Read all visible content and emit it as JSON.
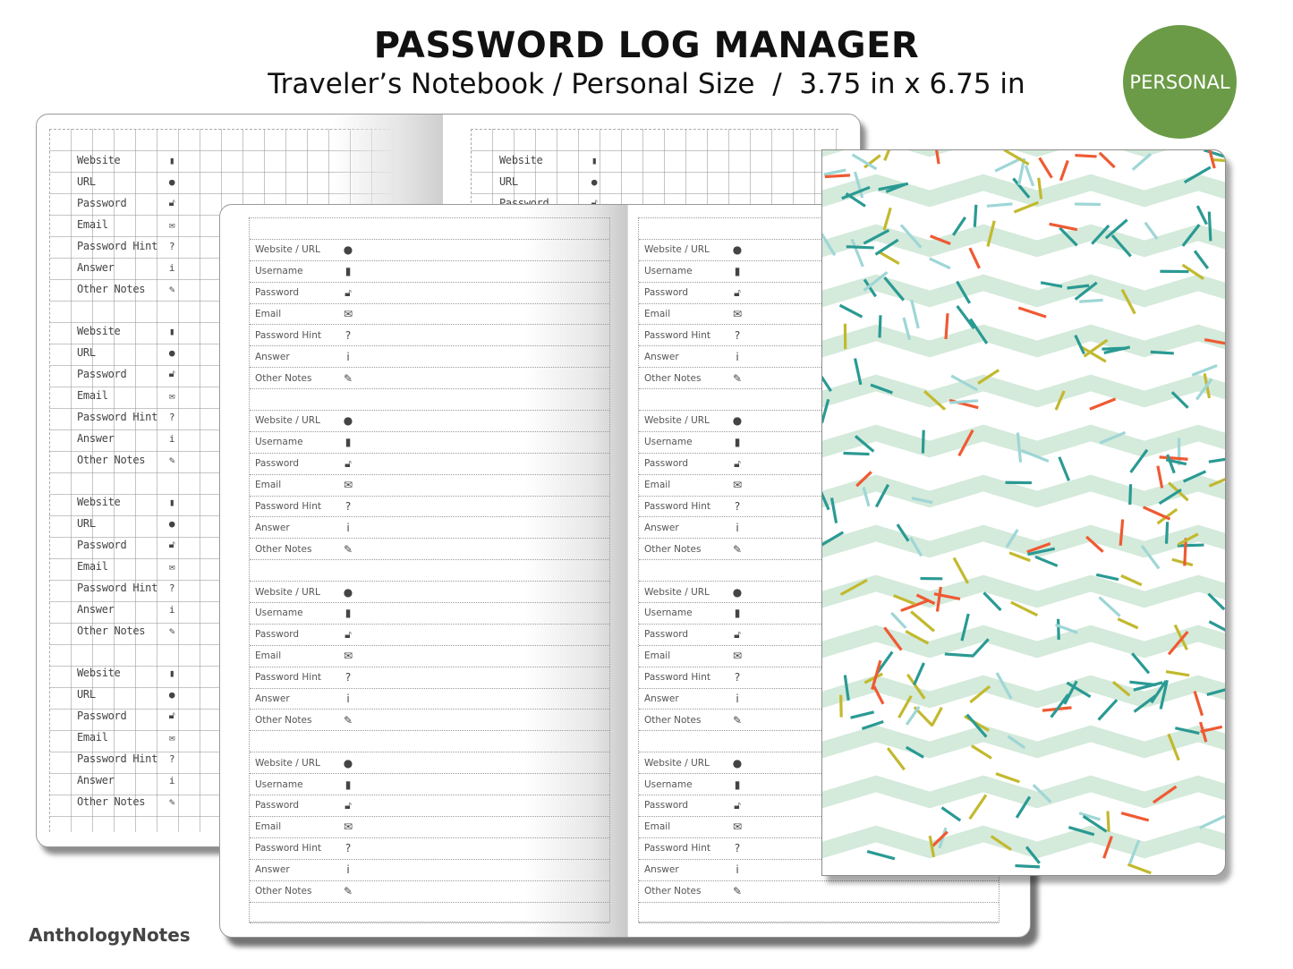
{
  "header": {
    "title": "PASSWORD LOG MANAGER",
    "subtitle": "Traveler’s Notebook / Personal Size  /  3.75 in x 6.75 in"
  },
  "badge": {
    "label": "PERSONAL",
    "color": "#6b9b46"
  },
  "brand": {
    "name": "AnthologyNotes"
  },
  "back_notebook": {
    "entry_fields": [
      {
        "label": "Website",
        "icon": "bookmark-icon",
        "glyph": "▮"
      },
      {
        "label": "URL",
        "icon": "globe-icon",
        "glyph": "●"
      },
      {
        "label": "Password",
        "icon": "unlock-icon",
        "glyph": "🔓︎"
      },
      {
        "label": "Email",
        "icon": "envelope-icon",
        "glyph": "✉"
      },
      {
        "label": "Password Hint",
        "icon": "question-icon",
        "glyph": "?"
      },
      {
        "label": "Answer",
        "icon": "info-icon",
        "glyph": "i"
      },
      {
        "label": "Other Notes",
        "icon": "pencil-icon",
        "glyph": "✎"
      }
    ],
    "entries_per_page": 4
  },
  "front_notebook": {
    "entry_fields": [
      {
        "label": "Website / URL",
        "icon": "globe-icon",
        "glyph": "●"
      },
      {
        "label": "Username",
        "icon": "bookmark-icon",
        "glyph": "▮"
      },
      {
        "label": "Password",
        "icon": "unlock-icon",
        "glyph": "🔓︎"
      },
      {
        "label": "Email",
        "icon": "envelope-icon",
        "glyph": "✉"
      },
      {
        "label": "Password Hint",
        "icon": "question-icon",
        "glyph": "?"
      },
      {
        "label": "Answer",
        "icon": "info-icon",
        "glyph": "i"
      },
      {
        "label": "Other Notes",
        "icon": "pencil-icon",
        "glyph": "✎"
      }
    ],
    "entries_per_page": 4
  },
  "cover": {
    "pattern": "zigzag-sprinkles",
    "colors": {
      "zigzag": "#d4eadb",
      "teal": "#2a9a93",
      "orange": "#ef5a33",
      "olive": "#c2b92e",
      "light_blue": "#9fd6d6"
    }
  }
}
